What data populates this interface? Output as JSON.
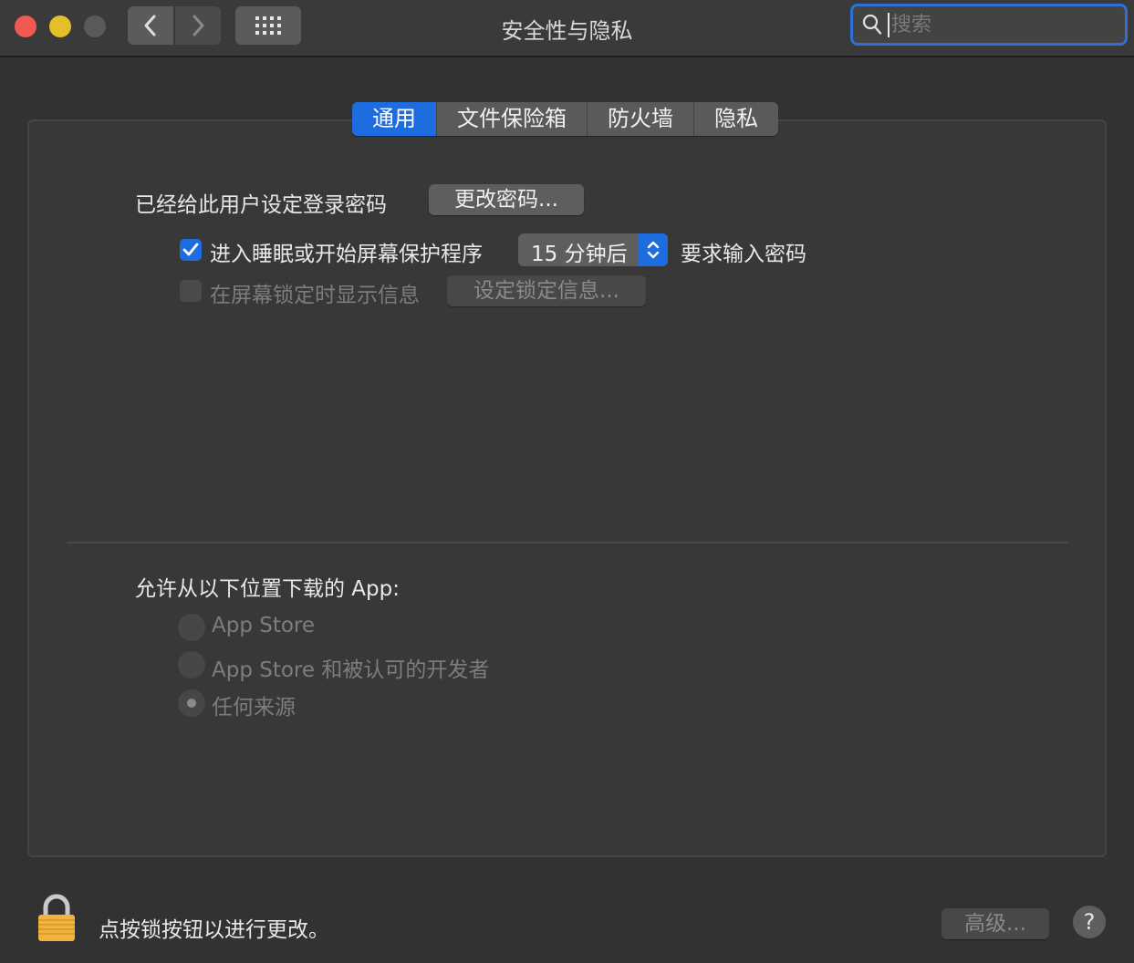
{
  "window": {
    "title": "安全性与隐私"
  },
  "search": {
    "placeholder": "搜索"
  },
  "tabs": [
    {
      "label": "通用",
      "active": true
    },
    {
      "label": "文件保险箱",
      "active": false
    },
    {
      "label": "防火墙",
      "active": false
    },
    {
      "label": "隐私",
      "active": false
    }
  ],
  "general": {
    "password_set_label": "已经给此用户设定登录密码",
    "change_password_button": "更改密码...",
    "require_password": {
      "checked": true,
      "label": "进入睡眠或开始屏幕保护程序",
      "delay_value": "15 分钟后",
      "suffix": "要求输入密码"
    },
    "lock_message": {
      "checked": false,
      "enabled": false,
      "label": "在屏幕锁定时显示信息",
      "button": "设定锁定信息..."
    }
  },
  "downloads": {
    "heading": "允许从以下位置下载的 App:",
    "options": [
      {
        "label": "App Store",
        "selected": false
      },
      {
        "label": "App Store 和被认可的开发者",
        "selected": false
      },
      {
        "label": "任何来源",
        "selected": true
      }
    ]
  },
  "footer": {
    "lock_text": "点按锁按钮以进行更改。",
    "advanced_button": "高级...",
    "help_label": "?"
  },
  "colors": {
    "accent": "#1e6de0",
    "background": "#323232"
  }
}
